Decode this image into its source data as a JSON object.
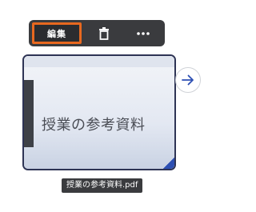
{
  "toolbar": {
    "edit_label": "編集",
    "delete_icon": "trash-icon",
    "more_icon": "more-horizontal-icon"
  },
  "card": {
    "thumbnail_title": "授業の参考資料",
    "filename": "授業の参考資料.pdf"
  },
  "navigation": {
    "next_icon": "arrow-right-icon"
  },
  "colors": {
    "toolbar_bg": "#3a3b3e",
    "highlight": "#e8681f",
    "card_border": "#2e3455",
    "accent_blue": "#2d4fb3"
  }
}
